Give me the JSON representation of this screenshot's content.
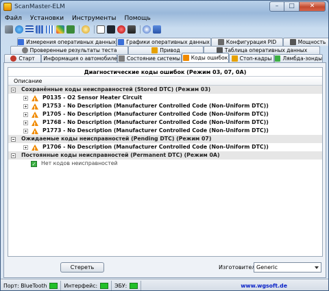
{
  "window": {
    "title": "ScanMaster-ELM",
    "controls": [
      "–",
      "□",
      "✕"
    ]
  },
  "menu": [
    "Файл",
    "Установки",
    "Инструменты",
    "Помощь"
  ],
  "toolbar_icons": [
    "wrench-icon",
    "globe-icon",
    "list-icon",
    "grid-icon",
    "grid2-icon",
    "chip-icon",
    "puzzle-icon",
    "gear-icon",
    "chat-icon",
    "monitor-icon",
    "red-circle-icon",
    "battery-icon",
    "info-icon",
    "exit-icon"
  ],
  "tabs": {
    "row1": [
      {
        "label": "Измерения оперативных данных",
        "icon": "chart-tab-icon",
        "color": "#3a6fd8"
      },
      {
        "label": "Графики оперативных данных",
        "icon": "graph-tab-icon",
        "color": "#3a6fd8"
      },
      {
        "label": "Конфигурация PID",
        "icon": "config-tab-icon",
        "color": "#6a6a6a"
      },
      {
        "label": "Мощность",
        "icon": "power-tab-icon",
        "color": "#555555"
      }
    ],
    "row2": [
      {
        "label": "Проверенные результаты теста",
        "icon": "test-tab-icon",
        "color": "#7d7d7d"
      },
      {
        "label": "Привод",
        "icon": "drive-tab-icon",
        "color": "#e6a100"
      },
      {
        "label": "Таблица оперативных данных",
        "icon": "table-tab-icon",
        "color": "#555555"
      }
    ],
    "row3": [
      {
        "label": "Старт",
        "icon": "start-tab-icon",
        "color": "#c0392b"
      },
      {
        "label": "Информация о автомобиле",
        "icon": "info-tab-icon",
        "color": "#3a6fd8"
      },
      {
        "label": "Состояние системы",
        "icon": "status-tab-icon",
        "color": "#7d7d7d"
      },
      {
        "label": "Коды ошибок",
        "icon": "warning-tab-icon",
        "color": "#f08a00",
        "active": true
      },
      {
        "label": "Стоп-кадры",
        "icon": "freeze-tab-icon",
        "color": "#e6a100"
      },
      {
        "label": "Лямбда-зонды",
        "icon": "lambda-tab-icon",
        "color": "#3cb043"
      }
    ]
  },
  "dtc_panel": {
    "title": "Диагностические коды ошибок (Режим 03, 07, 0A)",
    "column_header": "Описание",
    "groups": [
      {
        "label": "Сохранённые коды неисправностей (Stored DTC) (Режим 03)",
        "items": [
          "P0135 - O2 Sensor Heater Circuit",
          "P1753 - No Description (Manufacturer Controlled Code (Non-Uniform DTC))",
          "P1705 - No Description (Manufacturer Controlled Code (Non-Uniform DTC))",
          "P1768 - No Description (Manufacturer Controlled Code (Non-Uniform DTC))",
          "P1773 - No Description (Manufacturer Controlled Code (Non-Uniform DTC))"
        ]
      },
      {
        "label": "Ожидаемые коды неисправностей (Pending DTC) (Режим 07)",
        "items": [
          "P1706 - No Description (Manufacturer Controlled Code (Non-Uniform DTC))"
        ]
      },
      {
        "label": "Постоянные коды неисправностей (Permanent DTC) (Режим 0A)",
        "ok_text": "Нет кодов неисправностей"
      }
    ]
  },
  "actions": {
    "clear_label": "Стереть",
    "maker_label": "Изготовитель:",
    "maker_value": "Generic"
  },
  "status": {
    "port": "Порт: BlueTooth",
    "interface": "Интерфейс:",
    "ecu": "ЭБУ:",
    "website": "www.wgsoft.de",
    "led_color": "#22c02a"
  }
}
